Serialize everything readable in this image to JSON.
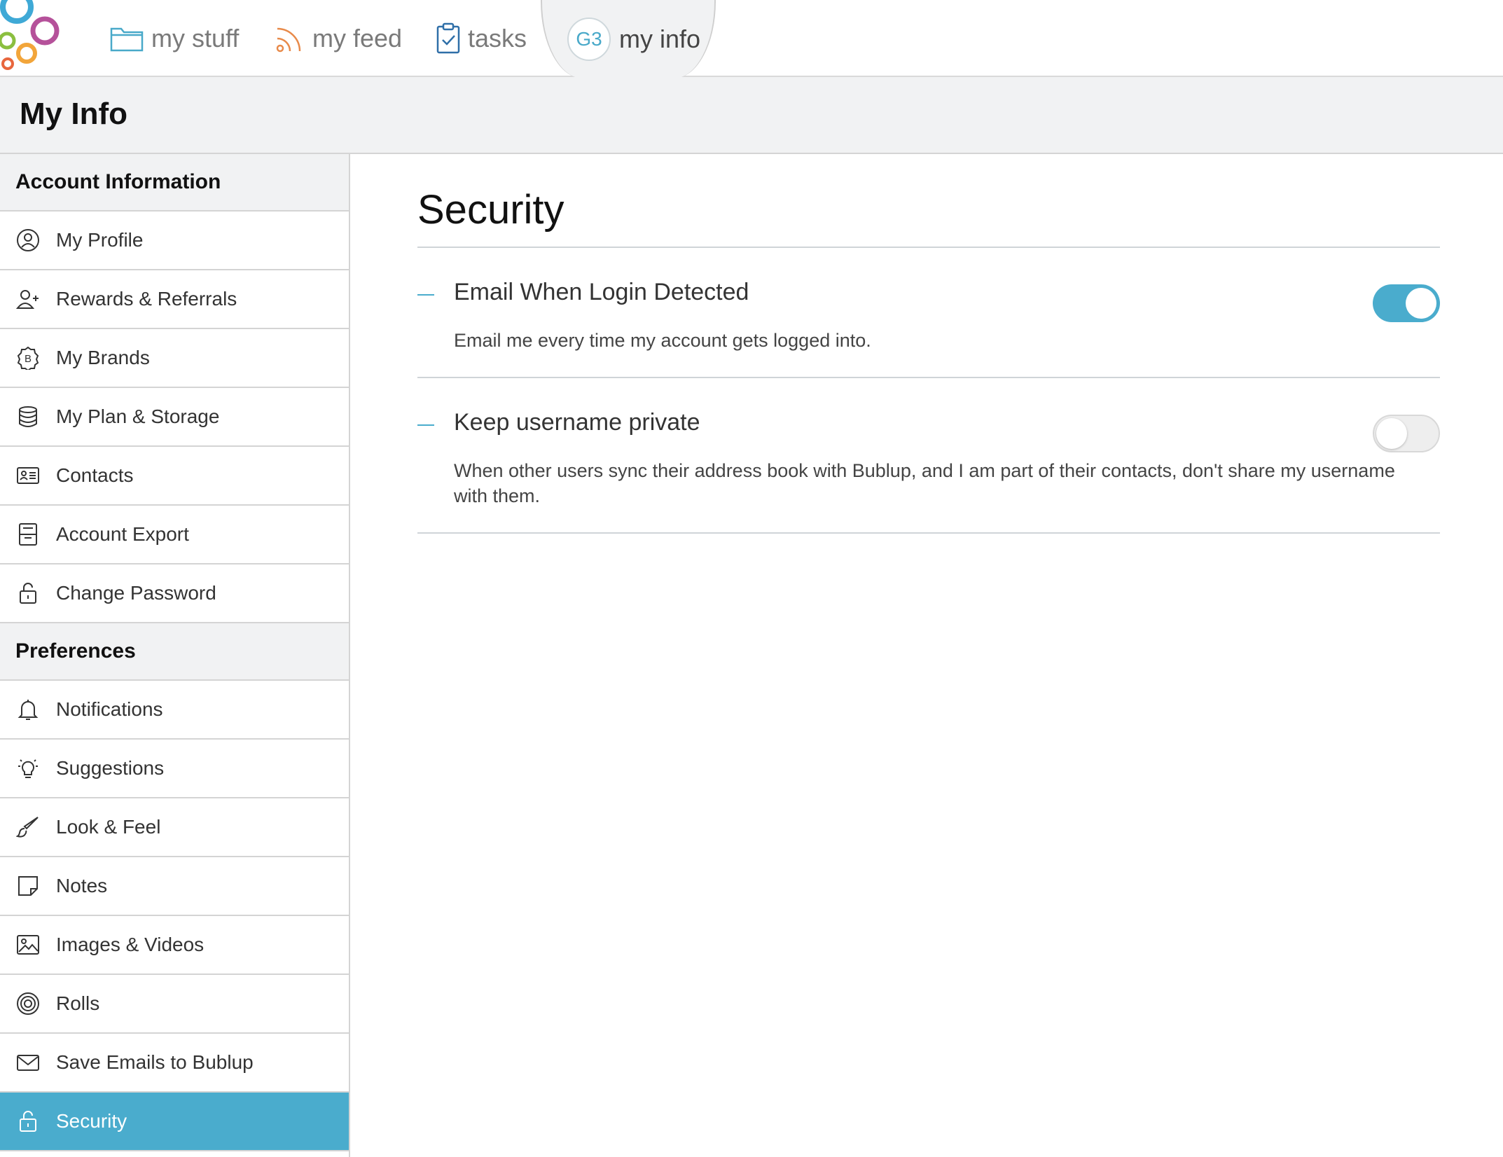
{
  "nav": {
    "tabs": [
      {
        "label": "my stuff",
        "icon": "folder-icon"
      },
      {
        "label": "my feed",
        "icon": "rss-icon"
      },
      {
        "label": "tasks",
        "icon": "clipboard-check-icon"
      },
      {
        "label": "my info",
        "icon": "avatar",
        "avatar_text": "G3",
        "active": true
      }
    ]
  },
  "page": {
    "title": "My Info"
  },
  "sidebar": {
    "sections": [
      {
        "title": "Account Information",
        "items": [
          {
            "label": "My Profile",
            "icon": "user-circle-icon"
          },
          {
            "label": "Rewards & Referrals",
            "icon": "user-plus-icon"
          },
          {
            "label": "My Brands",
            "icon": "brand-b-icon"
          },
          {
            "label": "My Plan & Storage",
            "icon": "database-icon"
          },
          {
            "label": "Contacts",
            "icon": "contact-card-icon"
          },
          {
            "label": "Account Export",
            "icon": "export-icon"
          },
          {
            "label": "Change Password",
            "icon": "lock-icon"
          }
        ]
      },
      {
        "title": "Preferences",
        "items": [
          {
            "label": "Notifications",
            "icon": "bell-icon"
          },
          {
            "label": "Suggestions",
            "icon": "lightbulb-icon"
          },
          {
            "label": "Look & Feel",
            "icon": "brush-icon"
          },
          {
            "label": "Notes",
            "icon": "note-icon"
          },
          {
            "label": "Images & Videos",
            "icon": "image-icon"
          },
          {
            "label": "Rolls",
            "icon": "spiral-icon"
          },
          {
            "label": "Save Emails to Bublup",
            "icon": "envelope-icon"
          },
          {
            "label": "Security",
            "icon": "lock-icon",
            "active": true
          }
        ]
      }
    ]
  },
  "main": {
    "title": "Security",
    "settings": [
      {
        "title": "Email When Login Detected",
        "description": "Email me every time my account gets logged into.",
        "enabled": true
      },
      {
        "title": "Keep username private",
        "description": "When other users sync their address book with Bublup, and I am part of their contacts, don't share my username with them.",
        "enabled": false
      }
    ]
  },
  "colors": {
    "accent": "#4aaccd",
    "header_bg": "#f1f2f3"
  }
}
